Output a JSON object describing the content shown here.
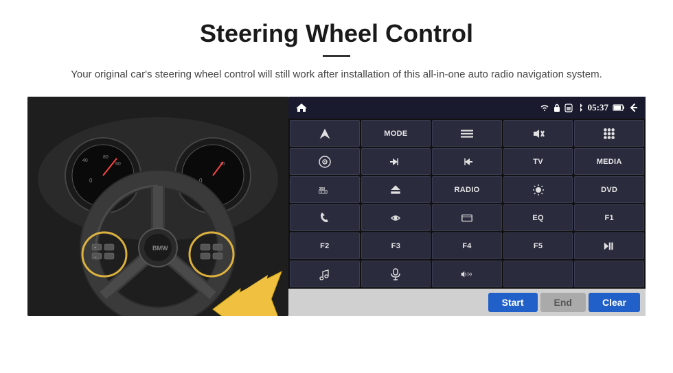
{
  "page": {
    "title": "Steering Wheel Control",
    "subtitle": "Your original car's steering wheel control will still work after installation of this all-in-one auto radio navigation system.",
    "divider_color": "#333333"
  },
  "status_bar": {
    "time": "05:37",
    "icons": [
      "wifi",
      "lock",
      "sim",
      "bluetooth",
      "battery",
      "screen",
      "back"
    ]
  },
  "button_grid": [
    [
      {
        "label": "",
        "icon": "home",
        "row": 1,
        "col": 1
      },
      {
        "label": "MODE",
        "icon": "",
        "row": 1,
        "col": 2
      },
      {
        "label": "",
        "icon": "menu",
        "row": 1,
        "col": 3
      },
      {
        "label": "",
        "icon": "mute",
        "row": 1,
        "col": 4
      },
      {
        "label": "",
        "icon": "dots",
        "row": 1,
        "col": 5
      }
    ],
    [
      {
        "label": "",
        "icon": "settings-circle",
        "row": 2,
        "col": 1
      },
      {
        "label": "",
        "icon": "prev",
        "row": 2,
        "col": 2
      },
      {
        "label": "",
        "icon": "next",
        "row": 2,
        "col": 3
      },
      {
        "label": "TV",
        "icon": "",
        "row": 2,
        "col": 4
      },
      {
        "label": "MEDIA",
        "icon": "",
        "row": 2,
        "col": 5
      }
    ],
    [
      {
        "label": "360",
        "icon": "car",
        "row": 3,
        "col": 1
      },
      {
        "label": "",
        "icon": "eject",
        "row": 3,
        "col": 2
      },
      {
        "label": "RADIO",
        "icon": "",
        "row": 3,
        "col": 3
      },
      {
        "label": "",
        "icon": "brightness",
        "row": 3,
        "col": 4
      },
      {
        "label": "DVD",
        "icon": "",
        "row": 3,
        "col": 5
      }
    ],
    [
      {
        "label": "",
        "icon": "phone",
        "row": 4,
        "col": 1
      },
      {
        "label": "",
        "icon": "swipe",
        "row": 4,
        "col": 2
      },
      {
        "label": "",
        "icon": "rectangle",
        "row": 4,
        "col": 3
      },
      {
        "label": "EQ",
        "icon": "",
        "row": 4,
        "col": 4
      },
      {
        "label": "F1",
        "icon": "",
        "row": 4,
        "col": 5
      }
    ],
    [
      {
        "label": "F2",
        "icon": "",
        "row": 5,
        "col": 1
      },
      {
        "label": "F3",
        "icon": "",
        "row": 5,
        "col": 2
      },
      {
        "label": "F4",
        "icon": "",
        "row": 5,
        "col": 3
      },
      {
        "label": "F5",
        "icon": "",
        "row": 5,
        "col": 4
      },
      {
        "label": "",
        "icon": "play-pause",
        "row": 5,
        "col": 5
      }
    ],
    [
      {
        "label": "",
        "icon": "music-note",
        "row": 6,
        "col": 1
      },
      {
        "label": "",
        "icon": "mic",
        "row": 6,
        "col": 2
      },
      {
        "label": "",
        "icon": "vol-phone",
        "row": 6,
        "col": 3
      },
      {
        "label": "",
        "icon": "",
        "row": 6,
        "col": 4
      },
      {
        "label": "",
        "icon": "",
        "row": 6,
        "col": 5
      }
    ]
  ],
  "action_bar": {
    "start_label": "Start",
    "end_label": "End",
    "clear_label": "Clear"
  }
}
